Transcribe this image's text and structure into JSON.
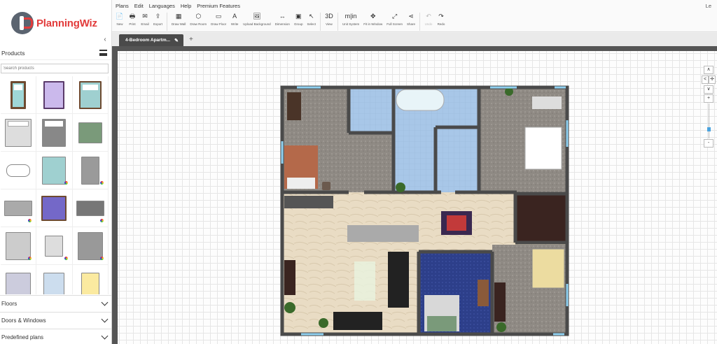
{
  "logo": {
    "name": "PlanningWiz"
  },
  "menu": [
    "Plans",
    "Edit",
    "Languages",
    "Help",
    "Premium Features"
  ],
  "user_initial": "Le",
  "toolbar": [
    {
      "icon": "📄",
      "label": "New"
    },
    {
      "icon": "🖶",
      "label": "Print"
    },
    {
      "icon": "✉",
      "label": "Email"
    },
    {
      "icon": "⇪",
      "label": "Export"
    },
    {
      "sep": true
    },
    {
      "icon": "▦",
      "label": "Draw Wall"
    },
    {
      "icon": "⬡",
      "label": "Draw Room"
    },
    {
      "icon": "▭",
      "label": "Draw Floor"
    },
    {
      "icon": "A",
      "label": "Write"
    },
    {
      "icon": "🖼",
      "label": "Upload Background"
    },
    {
      "icon": "↔",
      "label": "Dimension"
    },
    {
      "icon": "▣",
      "label": "Group"
    },
    {
      "icon": "↖",
      "label": "Select"
    },
    {
      "sep": true
    },
    {
      "icon": "3D",
      "label": "View"
    },
    {
      "sep": true
    },
    {
      "icon": "m|in",
      "label": "Unit System"
    },
    {
      "icon": "✥",
      "label": "Fit in Window"
    },
    {
      "icon": "⤢",
      "label": "Full Screen"
    },
    {
      "icon": "⋖",
      "label": "Share"
    },
    {
      "sep": true
    },
    {
      "icon": "↶",
      "label": "Undo",
      "disabled": true
    },
    {
      "icon": "↷",
      "label": "Redo"
    }
  ],
  "tabs": [
    {
      "label": "4-Bedroom Apartm..."
    }
  ],
  "sidebar": {
    "products_title": "Products",
    "search_placeholder": "Search products",
    "accordions": [
      "Floors",
      "Doors & Windows",
      "Predefined plans"
    ]
  },
  "colors": {
    "accent": "#e23c3c",
    "tab_bg": "#4a4a4a"
  }
}
